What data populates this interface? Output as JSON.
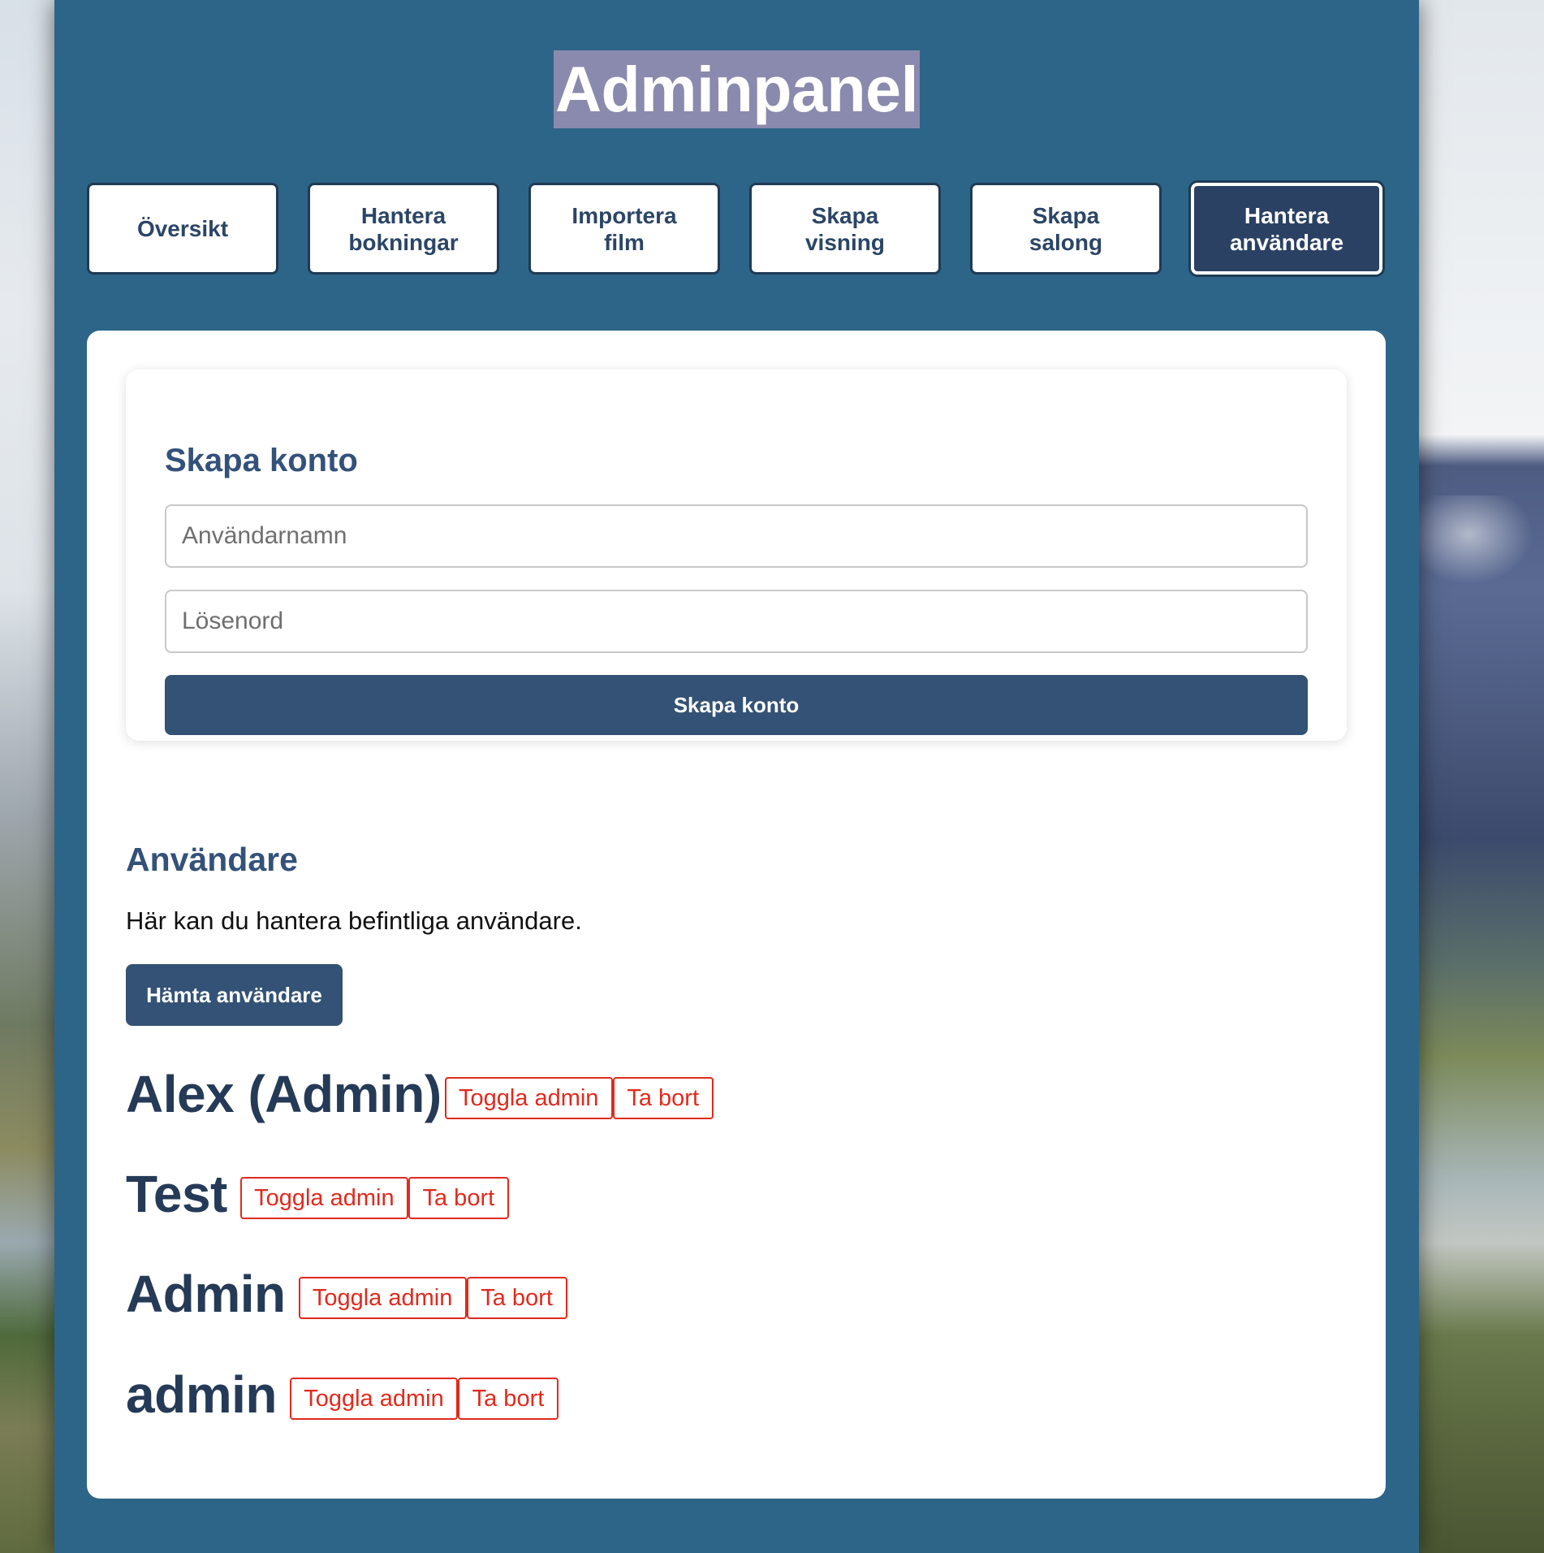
{
  "header": {
    "title": "Adminpanel"
  },
  "nav": {
    "items": [
      {
        "label": "Översikt",
        "active": false
      },
      {
        "label": "Hantera bokningar",
        "active": false
      },
      {
        "label": "Importera film",
        "active": false
      },
      {
        "label": "Skapa visning",
        "active": false
      },
      {
        "label": "Skapa salong",
        "active": false
      },
      {
        "label": "Hantera användare",
        "active": true
      }
    ]
  },
  "create_account": {
    "title": "Skapa konto",
    "username_placeholder": "Användarnamn",
    "username_value": "",
    "password_placeholder": "Lösenord",
    "password_value": "",
    "submit_label": "Skapa konto"
  },
  "users": {
    "title": "Användare",
    "description": "Här kan du hantera befintliga användare.",
    "fetch_label": "Hämta användare",
    "toggle_label": "Toggla admin",
    "delete_label": "Ta bort",
    "list": [
      {
        "name": "Alex (Admin)"
      },
      {
        "name": "Test"
      },
      {
        "name": "Admin"
      },
      {
        "name": "admin"
      }
    ]
  },
  "colors": {
    "panel_bg": "#2d6588",
    "primary": "#335275",
    "heading": "#34517a",
    "danger": "#e02a1d",
    "title_highlight": "#8a8aae"
  }
}
